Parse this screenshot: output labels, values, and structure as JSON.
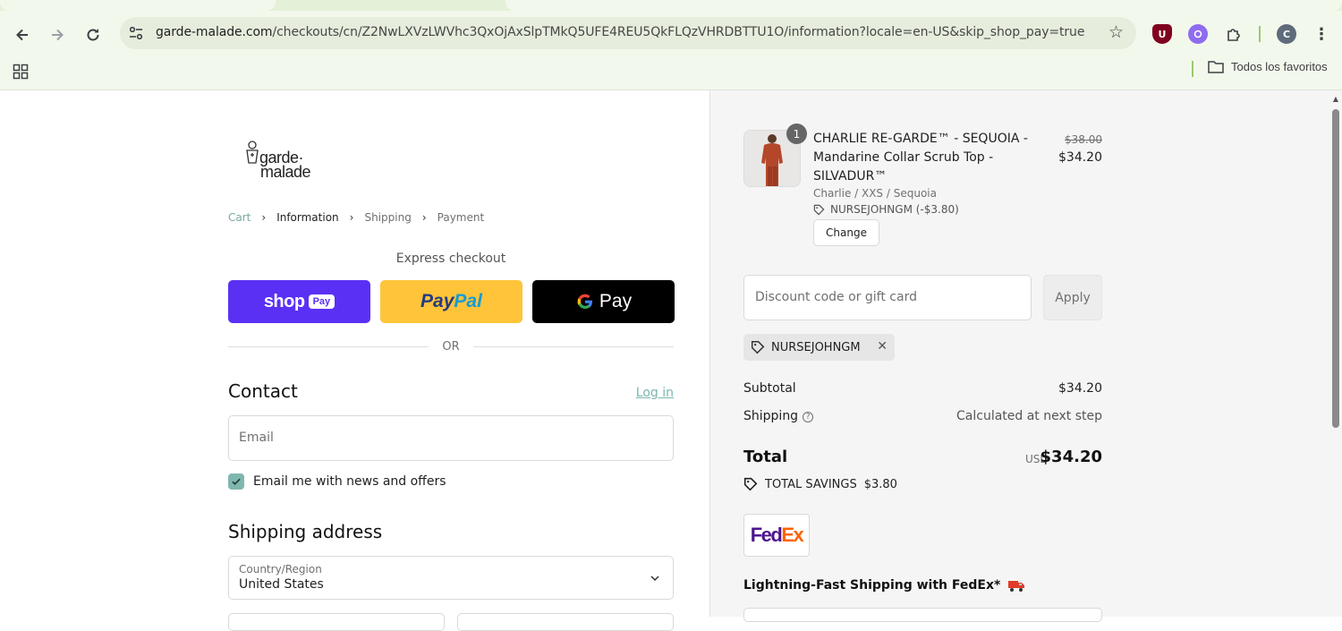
{
  "browser": {
    "url_host": "garde-malade.com",
    "url_path": "/checkouts/cn/Z2NwLXVzLWVhc3QxOjAxSlpTMkQ5UFE4REU5QkFLQzVHRDBTTU1O/information?locale=en-US&skip_shop_pay=true",
    "profile_initial": "C",
    "bookmark_folder": "Todos los favoritos",
    "ext_u_label": "U"
  },
  "brand": {
    "logo_line1": "garde·",
    "logo_line2": "malade"
  },
  "breadcrumb": {
    "cart": "Cart",
    "information": "Information",
    "shipping": "Shipping",
    "payment": "Payment"
  },
  "checkout": {
    "express_label": "Express checkout",
    "shop_pay_label": "shop",
    "shop_pay_badge": "Pay",
    "paypal_label_dark": "Pay",
    "paypal_label_light": "Pal",
    "gpay_label": "Pay",
    "or_label": "OR",
    "contact_heading": "Contact",
    "login_link": "Log in",
    "email_placeholder": "Email",
    "news_checkbox_label": "Email me with news and offers",
    "news_checked": true,
    "shipping_heading": "Shipping address",
    "country_label": "Country/Region",
    "country_value": "United States"
  },
  "summary": {
    "item": {
      "quantity": "1",
      "name": "CHARLIE RE-GARDE™ - SEQUOIA - Mandarine Collar Scrub Top - SILVADUR™",
      "variant": "Charlie / XXS / Sequoia",
      "discount_code": "NURSEJOHNGM (-$3.80)",
      "original_price": "$38.00",
      "price": "$34.20",
      "change_label": "Change"
    },
    "discount_placeholder": "Discount code or gift card",
    "apply_label": "Apply",
    "applied_code": "NURSEJOHNGM",
    "subtotal_label": "Subtotal",
    "subtotal_value": "$34.20",
    "shipping_label": "Shipping",
    "shipping_value": "Calculated at next step",
    "total_label": "Total",
    "total_currency": "USD",
    "total_value": "$34.20",
    "savings_label": "TOTAL SAVINGS",
    "savings_value": "$3.80",
    "fedex_fe": "Fed",
    "fedex_ex": "Ex",
    "fedex_heading": "Lightning-Fast Shipping with FedEx*"
  },
  "colors": {
    "shop_pay": "#5a31f4",
    "paypal": "#ffc439",
    "gpay": "#000000",
    "accent": "#7fb7ae"
  }
}
